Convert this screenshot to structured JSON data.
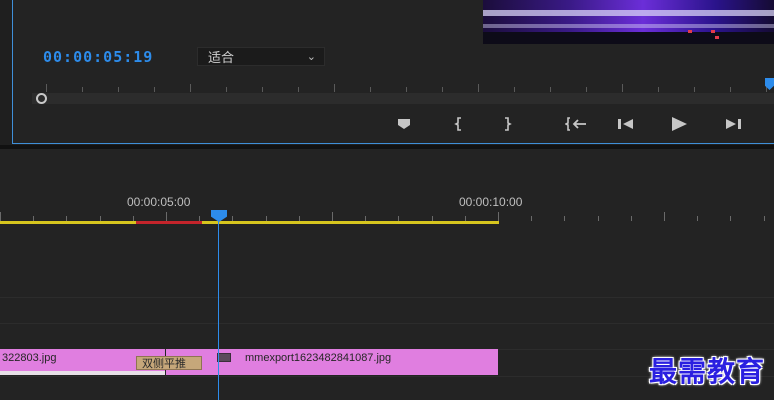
{
  "program_monitor": {
    "timecode": "00:00:05:19",
    "fit_select": {
      "value": "适合"
    },
    "transport_icons": [
      "add-marker-icon",
      "mark-in-icon",
      "mark-out-icon",
      "go-to-in-icon",
      "step-back-icon",
      "play-icon",
      "step-forward-icon"
    ]
  },
  "timeline": {
    "ruler_labels": [
      "00:00:05:00",
      "00:00:10:00"
    ],
    "clips": [
      {
        "name": "322803.jpg"
      },
      {
        "name": "mmexport1623482841087.jpg"
      }
    ],
    "transition": {
      "name": "双侧平推"
    }
  },
  "watermark": "最需教育",
  "colors": {
    "accent": "#2d8ceb",
    "clip": "#e07ee0",
    "work_area": "#d6c51e",
    "render_red": "#c4242b"
  }
}
